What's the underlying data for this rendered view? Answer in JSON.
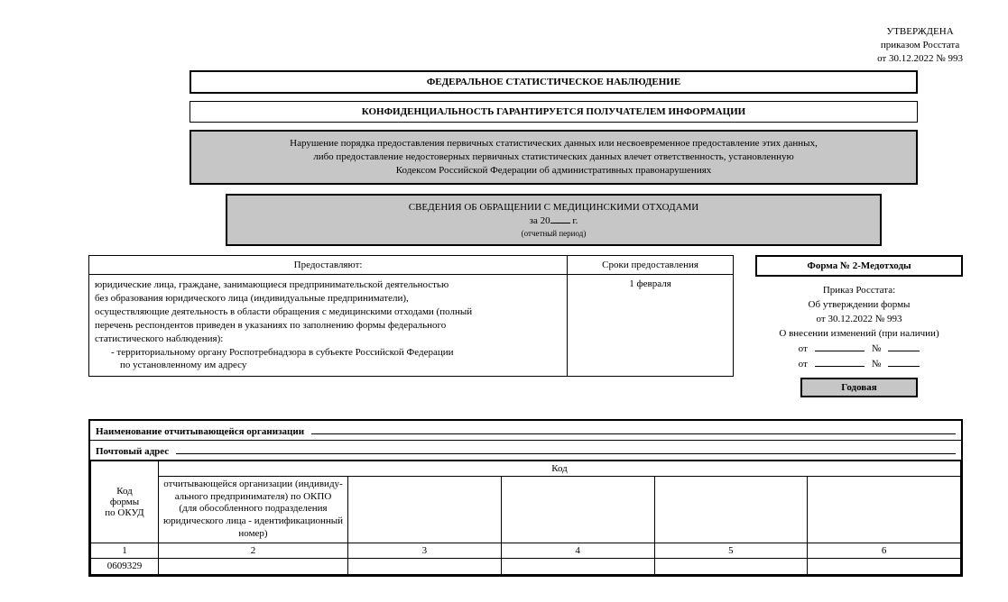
{
  "approval": {
    "line1": "УТВЕРЖДЕНА",
    "line2": "приказом Росстата",
    "line3": "от 30.12.2022 № 993"
  },
  "header": {
    "box1": "ФЕДЕРАЛЬНОЕ СТАТИСТИЧЕСКОЕ НАБЛЮДЕНИЕ",
    "box2": "КОНФИДЕНЦИАЛЬНОСТЬ ГАРАНТИРУЕТСЯ ПОЛУЧАТЕЛЕМ ИНФОРМАЦИИ",
    "grey1_l1": "Нарушение порядка предоставления первичных статистических данных или несвоевременное предоставление этих данных,",
    "grey1_l2": "либо предоставление недостоверных первичных статистических данных влечет ответственность, установленную",
    "grey1_l3": "Кодексом Российской Федерации об административных правонарушениях",
    "grey2_title": "СВЕДЕНИЯ ОБ ОБРАЩЕНИИ С МЕДИЦИНСКИМИ ОТХОДАМИ",
    "grey2_year_prefix": "за 20",
    "grey2_year_suffix": " г.",
    "grey2_sub": "(отчетный период)"
  },
  "provide": {
    "col1_header": "Предоставляют:",
    "col2_header": "Сроки предоставления",
    "body_l1": "юридические лица, граждане, занимающиеся предпринимательской деятельностью",
    "body_l2": "без образования юридического лица (индивидуальные предприниматели),",
    "body_l3": "осуществляющие деятельность в области обращения с медицинскими отходами (полный",
    "body_l4": "перечень респондентов приведен в указаниях по заполнению формы федерального",
    "body_l5": "статистического наблюдения):",
    "body_l6": "- территориальному органу Роспотребнадзора в субъекте Российской Федерации",
    "body_l7": "по установленному им адресу",
    "deadline": "1 февраля"
  },
  "side": {
    "form_name": "Форма № 2-Медотходы",
    "l1": "Приказ Росстата:",
    "l2": "Об утверждении формы",
    "l3": "от 30.12.2022 № 993",
    "l4": "О внесении изменений (при наличии)",
    "from_label": "от",
    "num_label": "№",
    "annual": "Годовая"
  },
  "org": {
    "name_label": "Наименование отчитывающейся организации",
    "addr_label": "Почтовый адрес"
  },
  "codes": {
    "okud_label_l1": "Код",
    "okud_label_l2": "формы",
    "okud_label_l3": "по ОКУД",
    "span_header": "Код",
    "desc_l1": "отчитывающейся организации (индивиду-",
    "desc_l2": "ального предпринимателя) по ОКПО",
    "desc_l3": "(для обособленного подразделения",
    "desc_l4": "юридического лица - идентификационный",
    "desc_l5": "номер)",
    "nums": {
      "c1": "1",
      "c2": "2",
      "c3": "3",
      "c4": "4",
      "c5": "5",
      "c6": "6"
    },
    "okud_value": "0609329"
  }
}
